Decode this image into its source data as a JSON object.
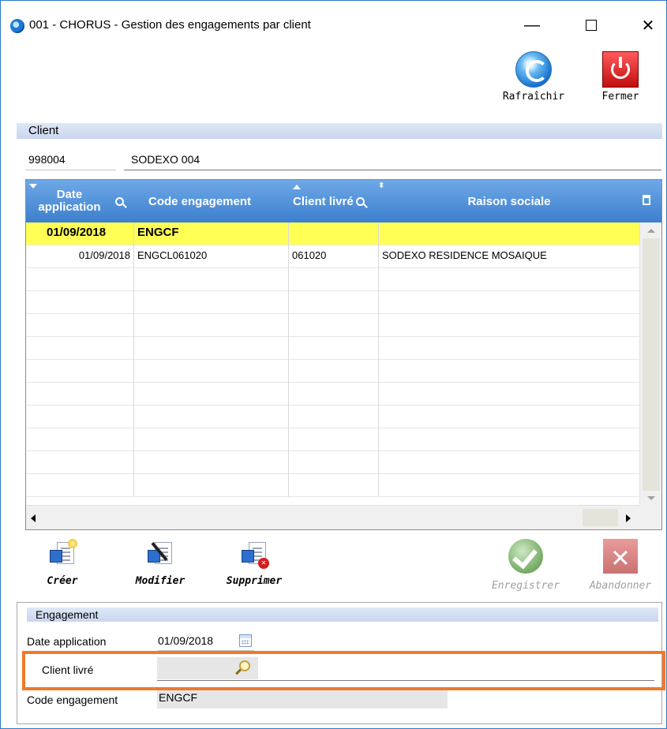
{
  "window": {
    "title": "001 - CHORUS - Gestion des engagements par client",
    "min_glyph": "—",
    "close_glyph": "✕"
  },
  "toolbar": {
    "refresh_label": "Rafraîchir",
    "close_label": "Fermer"
  },
  "client": {
    "section_label": "Client",
    "code": "998004",
    "name": "SODEXO 004"
  },
  "table": {
    "columns": [
      {
        "label": "Date application"
      },
      {
        "label": "Code engagement"
      },
      {
        "label": "Client livré"
      },
      {
        "label": "Raison sociale"
      }
    ],
    "rows": [
      {
        "date": "01/09/2018",
        "code": "ENGCF",
        "client": "",
        "raison": "",
        "selected": true
      },
      {
        "date": "01/09/2018",
        "code": "ENGCL061020",
        "client": "061020",
        "raison": "SODEXO RESIDENCE MOSAIQUE",
        "selected": false
      }
    ]
  },
  "actions": {
    "create": "Créer",
    "modify": "Modifier",
    "delete": "Supprimer",
    "save": "Enregistrer",
    "cancel": "Abandonner"
  },
  "engagement": {
    "section_label": "Engagement",
    "date_label": "Date application",
    "date_value": "01/09/2018",
    "client_label": "Client livré",
    "client_value": "",
    "code_label": "Code engagement",
    "code_value": "ENGCF"
  },
  "colors": {
    "header_blue": "#4a8ad8",
    "selected_row": "#ffff55",
    "highlight_orange": "#ee7a2a",
    "close_red": "#d21a1a"
  }
}
